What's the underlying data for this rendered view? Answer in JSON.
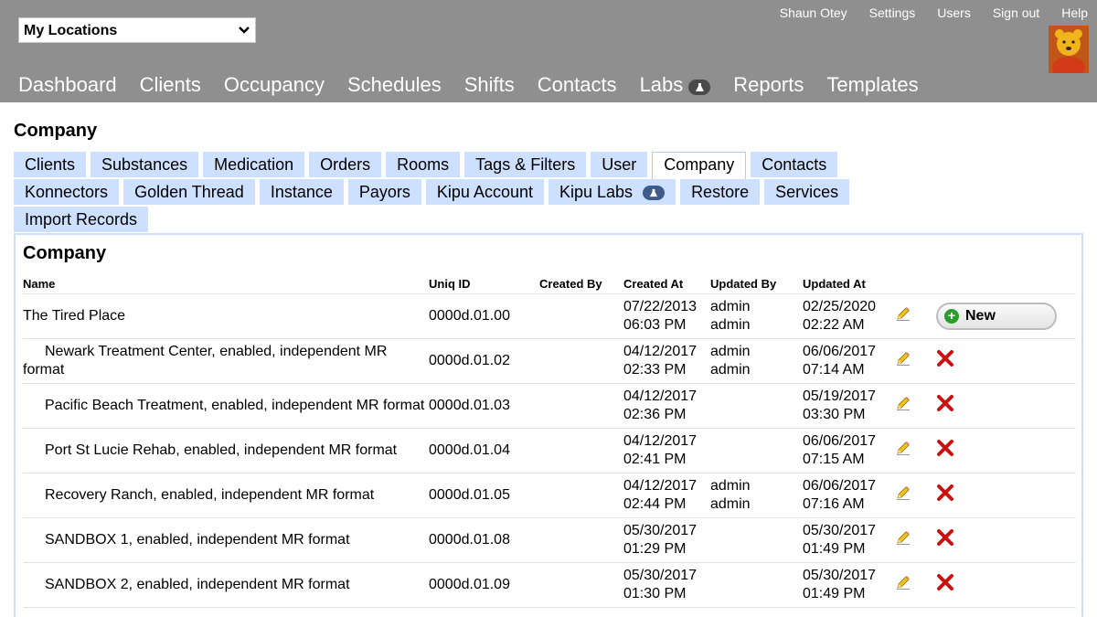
{
  "header": {
    "location_select": "My Locations",
    "user_links": [
      "Shaun Otey",
      "Settings",
      "Users",
      "Sign out",
      "Help"
    ],
    "nav": [
      "Dashboard",
      "Clients",
      "Occupancy",
      "Schedules",
      "Shifts",
      "Contacts",
      "Labs",
      "Reports",
      "Templates"
    ]
  },
  "page_title": "Company",
  "tabs": {
    "row1": [
      "Clients",
      "Substances",
      "Medication",
      "Orders",
      "Rooms",
      "Tags & Filters",
      "User",
      "Company",
      "Contacts"
    ],
    "row2": [
      "Konnectors",
      "Golden Thread",
      "Instance",
      "Payors",
      "Kipu Account",
      "Kipu Labs",
      "Restore",
      "Services"
    ],
    "row3": [
      "Import Records"
    ],
    "active": "Company"
  },
  "panel": {
    "title": "Company",
    "columns": [
      "Name",
      "Uniq ID",
      "Created By",
      "Created At",
      "Updated By",
      "Updated At"
    ],
    "new_button": "New",
    "rows": [
      {
        "name": "The Tired Place",
        "uid": "0000d.01.00",
        "created_by": "",
        "created_at": [
          "07/22/2013",
          "06:03 PM"
        ],
        "updated_by": [
          "admin",
          "admin"
        ],
        "updated_at": [
          "02/25/2020",
          "02:22 AM"
        ]
      },
      {
        "name": "Newark Treatment Center, enabled, independent MR format",
        "uid": "0000d.01.02",
        "created_by": "",
        "created_at": [
          "04/12/2017",
          "02:33 PM"
        ],
        "updated_by": [
          "admin",
          "admin"
        ],
        "updated_at": [
          "06/06/2017",
          "07:14 AM"
        ]
      },
      {
        "name": "Pacific Beach Treatment, enabled, independent MR format",
        "uid": "0000d.01.03",
        "created_by": "",
        "created_at": [
          "04/12/2017",
          "02:36 PM"
        ],
        "updated_by": [
          "",
          ""
        ],
        "updated_at": [
          "05/19/2017",
          "03:30 PM"
        ]
      },
      {
        "name": "Port St Lucie Rehab, enabled, independent MR format",
        "uid": "0000d.01.04",
        "created_by": "",
        "created_at": [
          "04/12/2017",
          "02:41 PM"
        ],
        "updated_by": [
          "",
          ""
        ],
        "updated_at": [
          "06/06/2017",
          "07:15 AM"
        ]
      },
      {
        "name": "Recovery Ranch, enabled, independent MR format",
        "uid": "0000d.01.05",
        "created_by": "",
        "created_at": [
          "04/12/2017",
          "02:44 PM"
        ],
        "updated_by": [
          "admin",
          "admin"
        ],
        "updated_at": [
          "06/06/2017",
          "07:16 AM"
        ]
      },
      {
        "name": "SANDBOX 1, enabled, independent MR format",
        "uid": "0000d.01.08",
        "created_by": "",
        "created_at": [
          "05/30/2017",
          "01:29 PM"
        ],
        "updated_by": [
          "",
          ""
        ],
        "updated_at": [
          "05/30/2017",
          "01:49 PM"
        ]
      },
      {
        "name": "SANDBOX 2, enabled, independent MR format",
        "uid": "0000d.01.09",
        "created_by": "",
        "created_at": [
          "05/30/2017",
          "01:30 PM"
        ],
        "updated_by": [
          "",
          ""
        ],
        "updated_at": [
          "05/30/2017",
          "01:49 PM"
        ]
      }
    ]
  },
  "colors": {
    "header_bg": "#8f8f8f",
    "tab_bg": "#cde0ff",
    "delete_red": "#cc1111"
  }
}
